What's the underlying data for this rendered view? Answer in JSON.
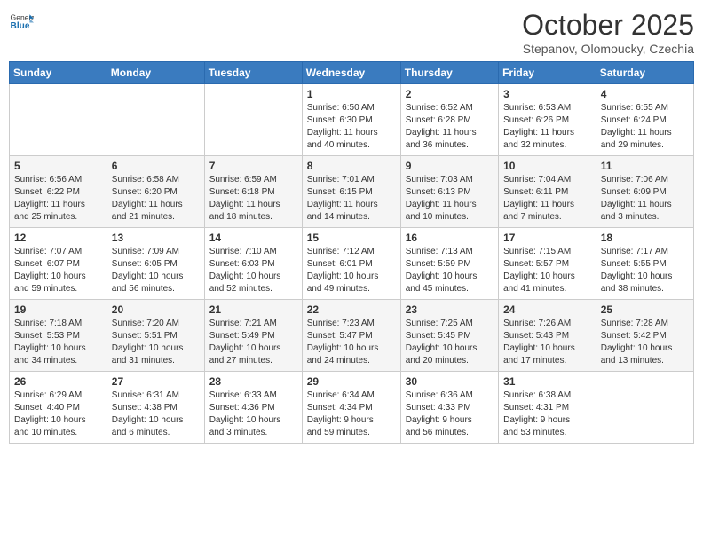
{
  "header": {
    "logo_general": "General",
    "logo_blue": "Blue",
    "month": "October 2025",
    "location": "Stepanov, Olomoucky, Czechia"
  },
  "weekdays": [
    "Sunday",
    "Monday",
    "Tuesday",
    "Wednesday",
    "Thursday",
    "Friday",
    "Saturday"
  ],
  "weeks": [
    [
      {
        "day": "",
        "info": ""
      },
      {
        "day": "",
        "info": ""
      },
      {
        "day": "",
        "info": ""
      },
      {
        "day": "1",
        "info": "Sunrise: 6:50 AM\nSunset: 6:30 PM\nDaylight: 11 hours\nand 40 minutes."
      },
      {
        "day": "2",
        "info": "Sunrise: 6:52 AM\nSunset: 6:28 PM\nDaylight: 11 hours\nand 36 minutes."
      },
      {
        "day": "3",
        "info": "Sunrise: 6:53 AM\nSunset: 6:26 PM\nDaylight: 11 hours\nand 32 minutes."
      },
      {
        "day": "4",
        "info": "Sunrise: 6:55 AM\nSunset: 6:24 PM\nDaylight: 11 hours\nand 29 minutes."
      }
    ],
    [
      {
        "day": "5",
        "info": "Sunrise: 6:56 AM\nSunset: 6:22 PM\nDaylight: 11 hours\nand 25 minutes."
      },
      {
        "day": "6",
        "info": "Sunrise: 6:58 AM\nSunset: 6:20 PM\nDaylight: 11 hours\nand 21 minutes."
      },
      {
        "day": "7",
        "info": "Sunrise: 6:59 AM\nSunset: 6:18 PM\nDaylight: 11 hours\nand 18 minutes."
      },
      {
        "day": "8",
        "info": "Sunrise: 7:01 AM\nSunset: 6:15 PM\nDaylight: 11 hours\nand 14 minutes."
      },
      {
        "day": "9",
        "info": "Sunrise: 7:03 AM\nSunset: 6:13 PM\nDaylight: 11 hours\nand 10 minutes."
      },
      {
        "day": "10",
        "info": "Sunrise: 7:04 AM\nSunset: 6:11 PM\nDaylight: 11 hours\nand 7 minutes."
      },
      {
        "day": "11",
        "info": "Sunrise: 7:06 AM\nSunset: 6:09 PM\nDaylight: 11 hours\nand 3 minutes."
      }
    ],
    [
      {
        "day": "12",
        "info": "Sunrise: 7:07 AM\nSunset: 6:07 PM\nDaylight: 10 hours\nand 59 minutes."
      },
      {
        "day": "13",
        "info": "Sunrise: 7:09 AM\nSunset: 6:05 PM\nDaylight: 10 hours\nand 56 minutes."
      },
      {
        "day": "14",
        "info": "Sunrise: 7:10 AM\nSunset: 6:03 PM\nDaylight: 10 hours\nand 52 minutes."
      },
      {
        "day": "15",
        "info": "Sunrise: 7:12 AM\nSunset: 6:01 PM\nDaylight: 10 hours\nand 49 minutes."
      },
      {
        "day": "16",
        "info": "Sunrise: 7:13 AM\nSunset: 5:59 PM\nDaylight: 10 hours\nand 45 minutes."
      },
      {
        "day": "17",
        "info": "Sunrise: 7:15 AM\nSunset: 5:57 PM\nDaylight: 10 hours\nand 41 minutes."
      },
      {
        "day": "18",
        "info": "Sunrise: 7:17 AM\nSunset: 5:55 PM\nDaylight: 10 hours\nand 38 minutes."
      }
    ],
    [
      {
        "day": "19",
        "info": "Sunrise: 7:18 AM\nSunset: 5:53 PM\nDaylight: 10 hours\nand 34 minutes."
      },
      {
        "day": "20",
        "info": "Sunrise: 7:20 AM\nSunset: 5:51 PM\nDaylight: 10 hours\nand 31 minutes."
      },
      {
        "day": "21",
        "info": "Sunrise: 7:21 AM\nSunset: 5:49 PM\nDaylight: 10 hours\nand 27 minutes."
      },
      {
        "day": "22",
        "info": "Sunrise: 7:23 AM\nSunset: 5:47 PM\nDaylight: 10 hours\nand 24 minutes."
      },
      {
        "day": "23",
        "info": "Sunrise: 7:25 AM\nSunset: 5:45 PM\nDaylight: 10 hours\nand 20 minutes."
      },
      {
        "day": "24",
        "info": "Sunrise: 7:26 AM\nSunset: 5:43 PM\nDaylight: 10 hours\nand 17 minutes."
      },
      {
        "day": "25",
        "info": "Sunrise: 7:28 AM\nSunset: 5:42 PM\nDaylight: 10 hours\nand 13 minutes."
      }
    ],
    [
      {
        "day": "26",
        "info": "Sunrise: 6:29 AM\nSunset: 4:40 PM\nDaylight: 10 hours\nand 10 minutes."
      },
      {
        "day": "27",
        "info": "Sunrise: 6:31 AM\nSunset: 4:38 PM\nDaylight: 10 hours\nand 6 minutes."
      },
      {
        "day": "28",
        "info": "Sunrise: 6:33 AM\nSunset: 4:36 PM\nDaylight: 10 hours\nand 3 minutes."
      },
      {
        "day": "29",
        "info": "Sunrise: 6:34 AM\nSunset: 4:34 PM\nDaylight: 9 hours\nand 59 minutes."
      },
      {
        "day": "30",
        "info": "Sunrise: 6:36 AM\nSunset: 4:33 PM\nDaylight: 9 hours\nand 56 minutes."
      },
      {
        "day": "31",
        "info": "Sunrise: 6:38 AM\nSunset: 4:31 PM\nDaylight: 9 hours\nand 53 minutes."
      },
      {
        "day": "",
        "info": ""
      }
    ]
  ]
}
